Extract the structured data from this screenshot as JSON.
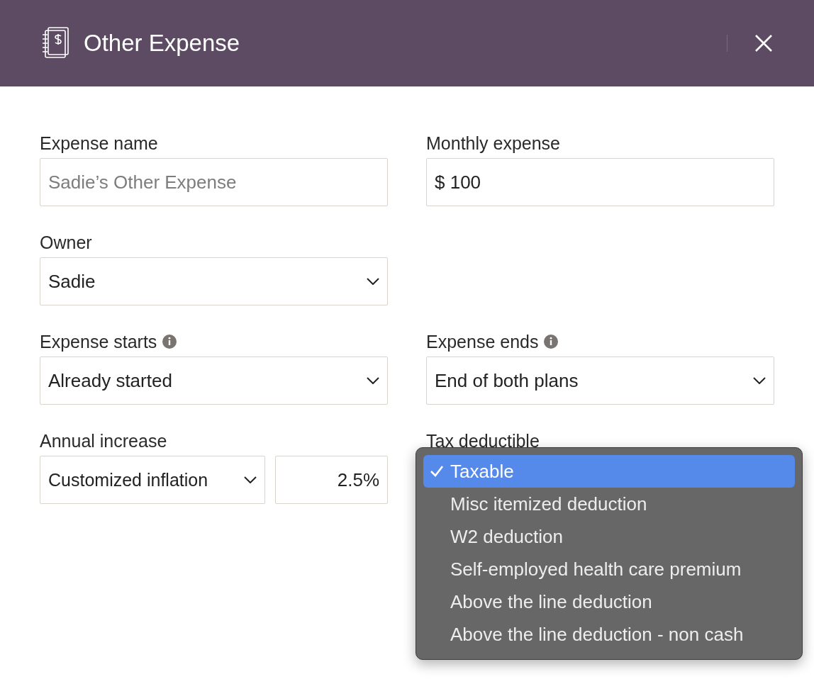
{
  "dialog": {
    "title": "Other Expense"
  },
  "fields": [
    {
      "kind": "text",
      "label": "Expense name",
      "placeholder": "Sadie’s Other Expense",
      "info": false
    },
    {
      "kind": "text",
      "label": "Monthly expense",
      "value": "$ 100",
      "info": false
    },
    {
      "kind": "select",
      "label": "Owner",
      "value": "Sadie",
      "info": false
    },
    {
      "kind": "empty"
    },
    {
      "kind": "select",
      "label": "Expense starts",
      "value": "Already started",
      "info": true
    },
    {
      "kind": "select",
      "label": "Expense ends",
      "value": "End of both plans",
      "info": true
    },
    {
      "kind": "pair",
      "label": "Annual increase",
      "value": "Customized inflation",
      "amount": "2.5%",
      "info": false
    },
    {
      "kind": "menu",
      "label": "Tax deductible",
      "info": false,
      "options": [
        {
          "label": "Taxable",
          "selected": true
        },
        {
          "label": "Misc itemized deduction",
          "selected": false
        },
        {
          "label": "W2 deduction",
          "selected": false
        },
        {
          "label": "Self-employed health care premium",
          "selected": false
        },
        {
          "label": "Above the line deduction",
          "selected": false
        },
        {
          "label": "Above the line deduction - non cash",
          "selected": false
        }
      ]
    }
  ]
}
